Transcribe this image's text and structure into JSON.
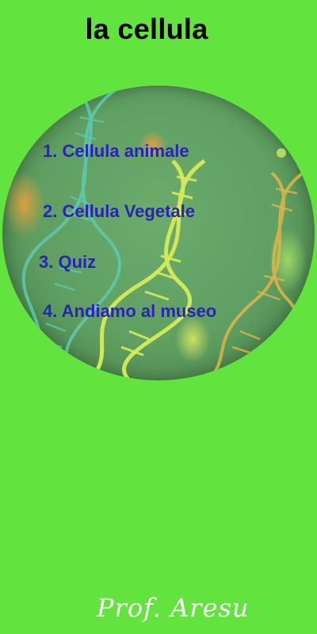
{
  "app": {
    "title": "la cellula"
  },
  "menu": {
    "items": [
      {
        "label": "1. Cellula animale"
      },
      {
        "label": "2. Cellula Vegetale"
      },
      {
        "label": "3. Quiz"
      },
      {
        "label": "4. Andiamo al museo"
      }
    ]
  },
  "footer": {
    "signature": "Prof. Aresu"
  },
  "colors": {
    "background": "#62e33e",
    "menu_text": "#2b23b8",
    "title_text": "#000000"
  },
  "icons": {
    "bubble_background": "dna-helix-icon"
  }
}
